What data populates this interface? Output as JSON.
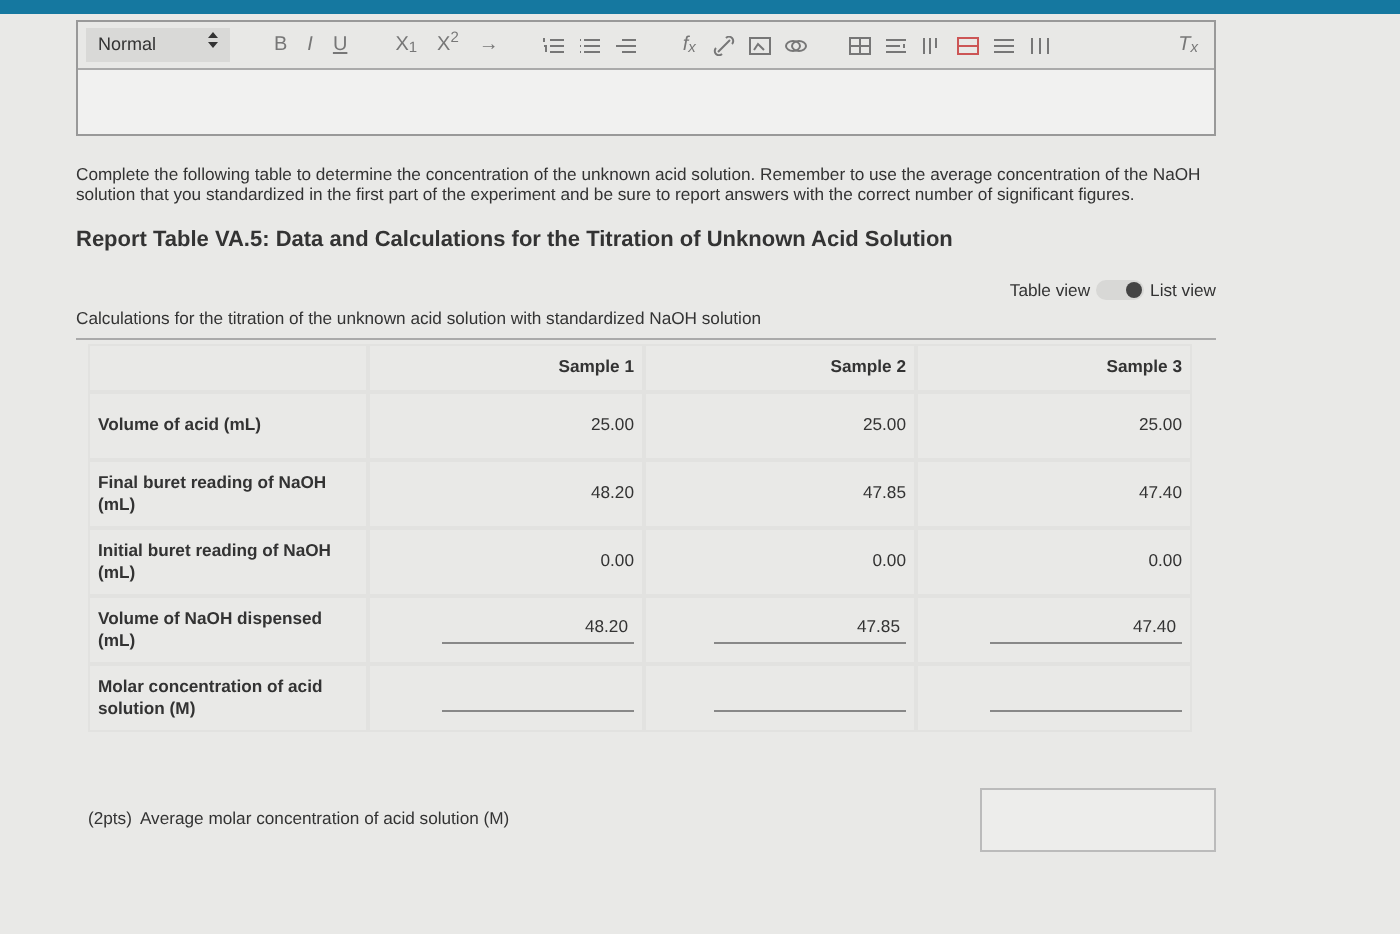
{
  "editor": {
    "format": "Normal",
    "format_buttons": [
      "B",
      "I",
      "U"
    ],
    "script_buttons": [
      "X$_{1}$",
      "X$^{2}$",
      "→"
    ],
    "formula_button": "f$_{x}$",
    "clear_button": "T$_{x}$"
  },
  "instructions": "Complete the following table to determine the concentration of the unknown acid solution. Remember to use the average concentration of the NaOH solution that you standardized in the first part of the experiment and be sure to report answers with the correct number of significant figures.",
  "table_title": "Report Table VA.5: Data and Calculations for the Titration of Unknown Acid Solution",
  "view_toggle": {
    "left_label": "Table view",
    "right_label": "List view",
    "on": true
  },
  "table": {
    "caption": "Calculations for the titration of the unknown acid solution with standardized NaOH solution",
    "columns": [
      "Sample 1",
      "Sample 2",
      "Sample 3"
    ],
    "rows": [
      {
        "label": "Volume of acid (mL)",
        "cells": [
          {
            "kind": "text",
            "value": "25.00"
          },
          {
            "kind": "text",
            "value": "25.00"
          },
          {
            "kind": "text",
            "value": "25.00"
          }
        ]
      },
      {
        "label": "Final buret reading of NaOH (mL)",
        "cells": [
          {
            "kind": "text",
            "value": "48.20"
          },
          {
            "kind": "text",
            "value": "47.85"
          },
          {
            "kind": "text",
            "value": "47.40"
          }
        ]
      },
      {
        "label": "Initial buret reading of NaOH (mL)",
        "cells": [
          {
            "kind": "text",
            "value": "0.00"
          },
          {
            "kind": "text",
            "value": "0.00"
          },
          {
            "kind": "text",
            "value": "0.00"
          }
        ]
      },
      {
        "label": "Volume of NaOH dispensed (mL)",
        "cells": [
          {
            "kind": "input",
            "value": "48.20"
          },
          {
            "kind": "input",
            "value": "47.85"
          },
          {
            "kind": "input",
            "value": "47.40"
          }
        ]
      },
      {
        "label": "Molar concentration of acid solution (M)",
        "cells": [
          {
            "kind": "input"
          },
          {
            "kind": "input"
          },
          {
            "kind": "input"
          }
        ]
      }
    ]
  },
  "average": {
    "points": "(2pts)",
    "label": "Average molar concentration of acid solution (M)"
  }
}
